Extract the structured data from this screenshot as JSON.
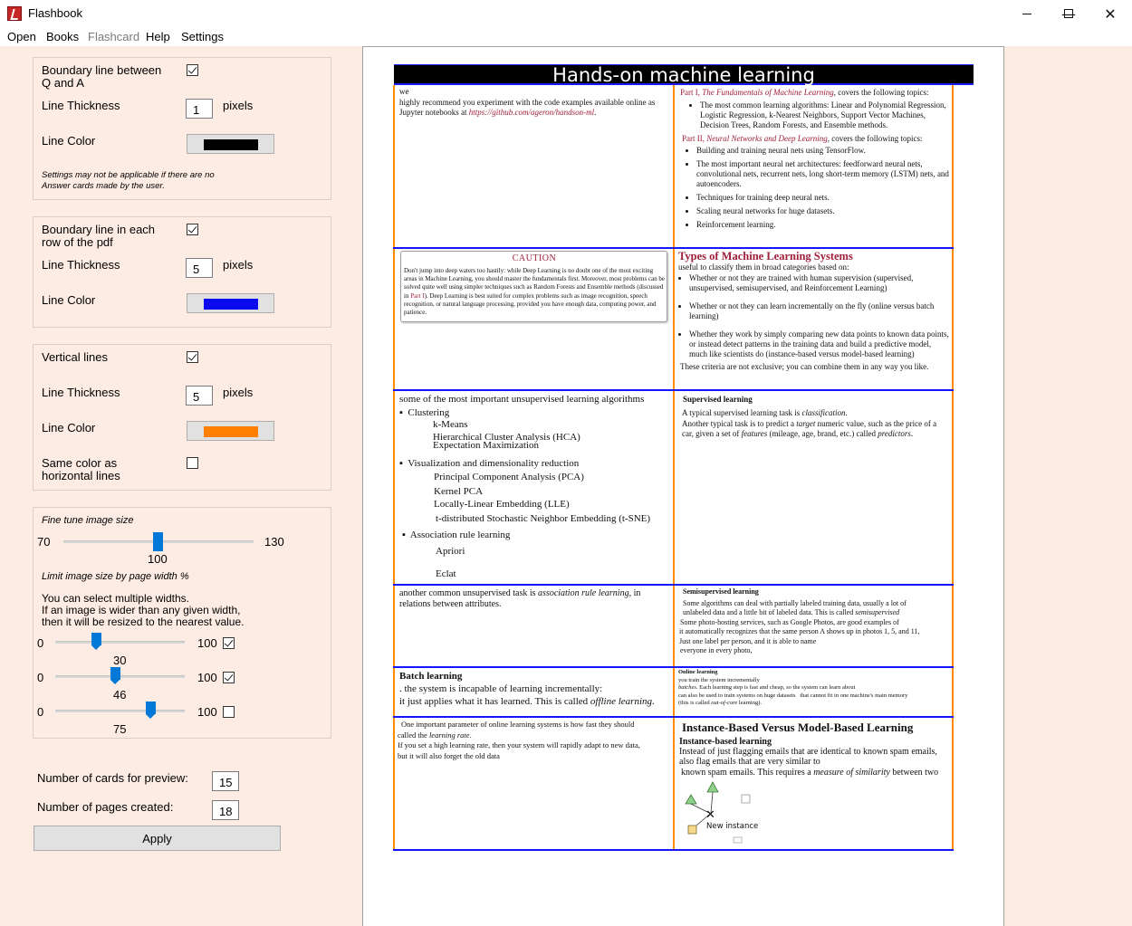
{
  "window": {
    "title": "Flashbook",
    "minimize": "—",
    "maximize": "☐",
    "close": "✕"
  },
  "menu": [
    "Open",
    "Books",
    "Flashcard",
    "Help",
    "Settings"
  ],
  "settings": {
    "qa_boundary": {
      "label": "Boundary line between Q and A",
      "checked": true,
      "thickness_label": "Line Thickness",
      "thickness": "1",
      "unit": "pixels",
      "color_label": "Line Color",
      "color": "#000000",
      "note": "Settings may not be applicable if there are no Answer cards made by the user."
    },
    "row_boundary": {
      "label": "Boundary line in each row of the pdf",
      "checked": true,
      "thickness_label": "Line Thickness",
      "thickness": "5",
      "unit": "pixels",
      "color_label": "Line Color",
      "color": "#0a0aef"
    },
    "vertical": {
      "label": "Vertical lines",
      "checked": true,
      "thickness_label": "Line Thickness",
      "thickness": "5",
      "unit": "pixels",
      "color_label": "Line Color",
      "color": "#ff8000",
      "same_color_label": "Same color as horizontal lines",
      "same_color_checked": false
    },
    "image_size": {
      "fine_tune_label": "Fine tune image size",
      "min": "70",
      "max": "130",
      "value": "100",
      "limit_label": "Limit image size by page width %",
      "help1": "You can select multiple widths.",
      "help2": "If an image is wider than any given width,",
      "help3": "then it will be resized to the nearest value.",
      "widths": [
        {
          "min": "0",
          "max": "100",
          "value": "30",
          "checked": true
        },
        {
          "min": "0",
          "max": "100",
          "value": "46",
          "checked": true
        },
        {
          "min": "0",
          "max": "100",
          "value": "75",
          "checked": false
        }
      ]
    },
    "preview_label": "Number of cards for preview:",
    "preview_value": "15",
    "pages_label": "Number of pages created:",
    "pages_value": "18",
    "apply_label": "Apply"
  },
  "document": {
    "title": "Hands-on machine learning",
    "r1_left": [
      "we",
      "highly recommend you experiment with the code examples available online as Jupyter notebooks at ",
      "https://github.com/ageron/handson-ml",
      "."
    ],
    "r1_right": {
      "p1a": "Part I, ",
      "p1b": "The Fundamentals of Machine Learning",
      "p1c": ", covers the following topics:",
      "b1": "The most common learning algorithms: Linear and Polynomial Regression, Logistic Regression, k-Nearest Neighbors, Support Vector Machines, Decision Trees, Random Forests, and Ensemble methods.",
      "p2a": "Part II, ",
      "p2b": "Neural Networks and Deep Learning",
      "p2c": ", covers the following topics:",
      "bullets": [
        "Building and training neural nets using TensorFlow.",
        "The most important neural net architectures: feedforward neural nets, convolutional nets, recurrent nets, long short-term memory (LSTM) nets, and autoencoders.",
        "Techniques for training deep neural nets.",
        "Scaling neural networks for huge datasets.",
        "Reinforcement learning."
      ]
    },
    "caution": {
      "heading": "CAUTION",
      "text1": "Don't jump into deep waters too hastily: while Deep Learning is no doubt one of the most exciting areas in Machine Learning, you should master the fundamentals first. Moreover, most problems can be solved quite well using simpler techniques such as Random Forests and Ensemble methods (discussed in ",
      "link": "Part I",
      "text2": "). Deep Learning is best suited for complex problems such as image recognition, speech recognition, or natural language processing, provided you have enough data, computing power, and patience."
    },
    "r2_right": {
      "heading": "Types of Machine Learning Systems",
      "intro": "useful to classify them in broad categories based on:",
      "bullets": [
        "Whether or not they are trained with human supervision (supervised, unsupervised, semisupervised, and Reinforcement Learning)",
        "Whether or not they can learn incrementally on the fly (online versus batch learning)",
        "Whether they work by simply comparing new data points to known data points, or instead detect patterns in the training data and build a predictive model, much like scientists do (instance-based versus model-based learning)"
      ],
      "outro": "These criteria are not exclusive; you can combine them in any way you like."
    },
    "r3_left": {
      "heading": "some of the most important unsupervised learning algorithms",
      "clustering": "Clustering",
      "c_items": [
        "k-Means",
        "Hierarchical Cluster Analysis (HCA)",
        "Expectation Maximization"
      ],
      "viz": "Visualization and dimensionality reduction",
      "v_items": [
        "Principal Component Analysis (PCA)",
        "Kernel PCA",
        "Locally-Linear Embedding (LLE)",
        "t-distributed Stochastic Neighbor Embedding (t-SNE)"
      ],
      "assoc": "Association rule learning",
      "a_items": [
        "Apriori",
        "Eclat"
      ]
    },
    "r3_right": {
      "heading": "Supervised learning",
      "t1a": "A typical supervised learning task is ",
      "t1b": "classification",
      "t1c": ".",
      "t2a": "Another typical task is to predict a ",
      "t2b": "target",
      "t2c": " numeric value, such as the price of a car, given a set of ",
      "t2d": "features",
      "t2e": " (mileage, age, brand, etc.) called ",
      "t2f": "predictors",
      "t2g": "."
    },
    "r4_left": {
      "a": "another common unsupervised task is ",
      "b": "association rule learning",
      "c": ", in relations between attributes."
    },
    "r4_right": {
      "heading": "Semisupervised learning",
      "l1": "Some algorithms can deal with partially labeled training data, usually a lot of",
      "l2a": "unlabeled data and a little bit of labeled data. This is called ",
      "l2b": "semisupervised",
      "l3": "Some photo-hosting services, such as Google Photos, are good examples of",
      "l4": "it automatically recognizes that the same person A shows up in photos 1, 5, and 11,",
      "l5": "Just one label per person, and it is able to name",
      "l6": "everyone in every photo,"
    },
    "r5_left": {
      "heading": "Batch learning",
      "l1": ". the system is incapable of learning incrementally:",
      "l2a": "it just applies what it has learned. This is called ",
      "l2b": "offline learning",
      "l2c": "."
    },
    "r5_right": {
      "heading": "Online learning",
      "l1": "you train the system incrementally",
      "l2a": "batches",
      "l2b": ". Each learning step is fast and cheap, so the system can learn about",
      "l3a": "can also be used to train systems on huge datasets",
      "l3b": "that cannot fit in one machine's main memory",
      "l4a": "(this is called ",
      "l4b": "out-of-core",
      "l4c": " learning)."
    },
    "r6_left": {
      "l1": "One important parameter of online learning systems is how fast they should",
      "l2a": "called the ",
      "l2b": "learning rate",
      "l2c": ".",
      "l3": "If you set a high   learning rate, then your system will rapidly adapt to new data,",
      "l4": "but it will also   forget the old data"
    },
    "r6_right": {
      "heading": "Instance-Based Versus Model-Based Learning",
      "sub": "Instance-based learning",
      "l1": "Instead of just flagging emails that are identical to known spam emails,",
      "l2": "also flag emails that are very similar to",
      "l3a": "known spam emails. This requires a ",
      "l3b": "measure of similarity",
      "l3c": " between two",
      "figure_label": "New instance"
    }
  }
}
